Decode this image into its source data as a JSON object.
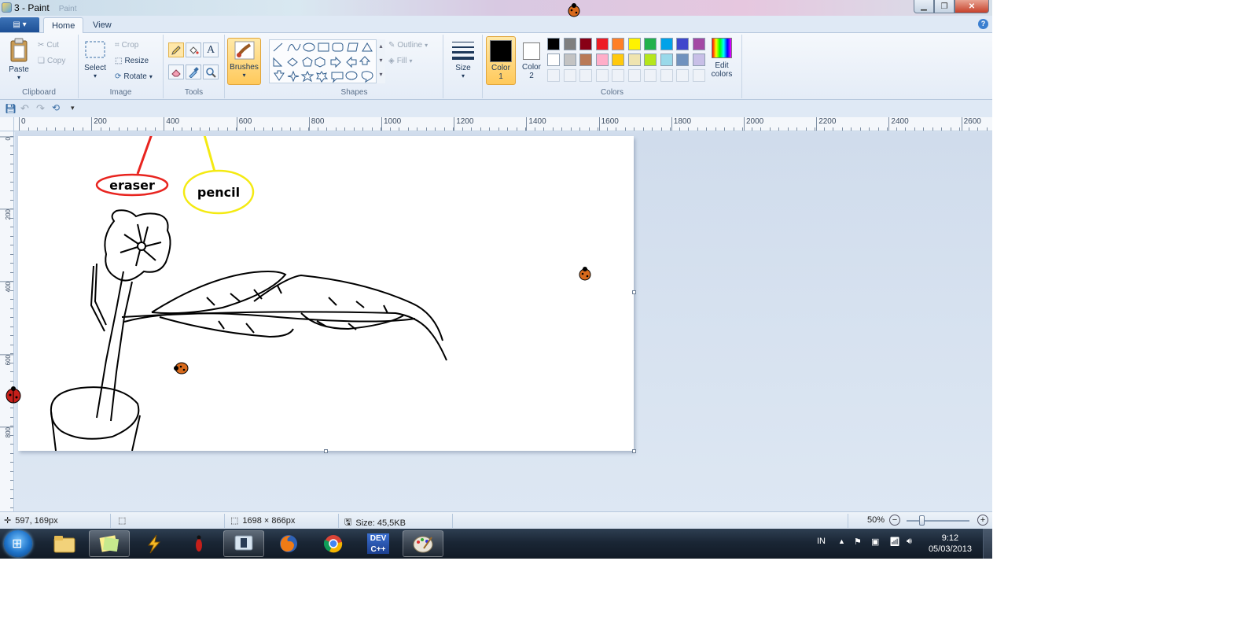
{
  "window": {
    "title": "3 - Paint",
    "title_faded": "Paint"
  },
  "tabs": [
    {
      "label": "Home",
      "active": true
    },
    {
      "label": "View",
      "active": false
    }
  ],
  "ribbon": {
    "clipboard": {
      "label": "Clipboard",
      "paste": "Paste",
      "cut": "Cut",
      "copy": "Copy"
    },
    "image": {
      "label": "Image",
      "select": "Select",
      "crop": "Crop",
      "resize": "Resize",
      "rotate": "Rotate"
    },
    "tools": {
      "label": "Tools"
    },
    "brushes": {
      "label": "Brushes"
    },
    "shapes": {
      "label": "Shapes",
      "outline": "Outline",
      "fill": "Fill"
    },
    "size": {
      "label": "Size"
    },
    "colors": {
      "label": "Colors",
      "color1_line1": "Color",
      "color1_line2": "1",
      "color2_line1": "Color",
      "color2_line2": "2",
      "edit_line1": "Edit",
      "edit_line2": "colors",
      "color1": "#000000",
      "color2": "#ffffff",
      "row1": [
        "#000000",
        "#7f7f7f",
        "#880015",
        "#ed1c24",
        "#ff7f27",
        "#fff200",
        "#22b14c",
        "#00a2e8",
        "#3f48cc",
        "#a349a4"
      ],
      "row2": [
        "#ffffff",
        "#c3c3c3",
        "#b97a57",
        "#ffaec9",
        "#ffc90e",
        "#efe4b0",
        "#b5e61d",
        "#99d9ea",
        "#7092be",
        "#c8bfe7"
      ]
    }
  },
  "ruler": {
    "h": [
      "0",
      "200",
      "400",
      "600",
      "800",
      "1000",
      "1200",
      "1400",
      "1600",
      "1800",
      "2000",
      "2200",
      "2400",
      "2600"
    ],
    "v": [
      "0",
      "200",
      "400",
      "600",
      "800"
    ]
  },
  "annotations": {
    "eraser": "eraser",
    "pencil": "pencil"
  },
  "status": {
    "cursor": "597, 169px",
    "dimensions": "1698 × 866px",
    "size": "Size: 45,5KB",
    "zoom": "50%",
    "zoom_level": 0.5
  },
  "taskbar": {
    "lang": "IN",
    "time": "9:12",
    "date": "05/03/2013",
    "dev_label": "DEV"
  }
}
